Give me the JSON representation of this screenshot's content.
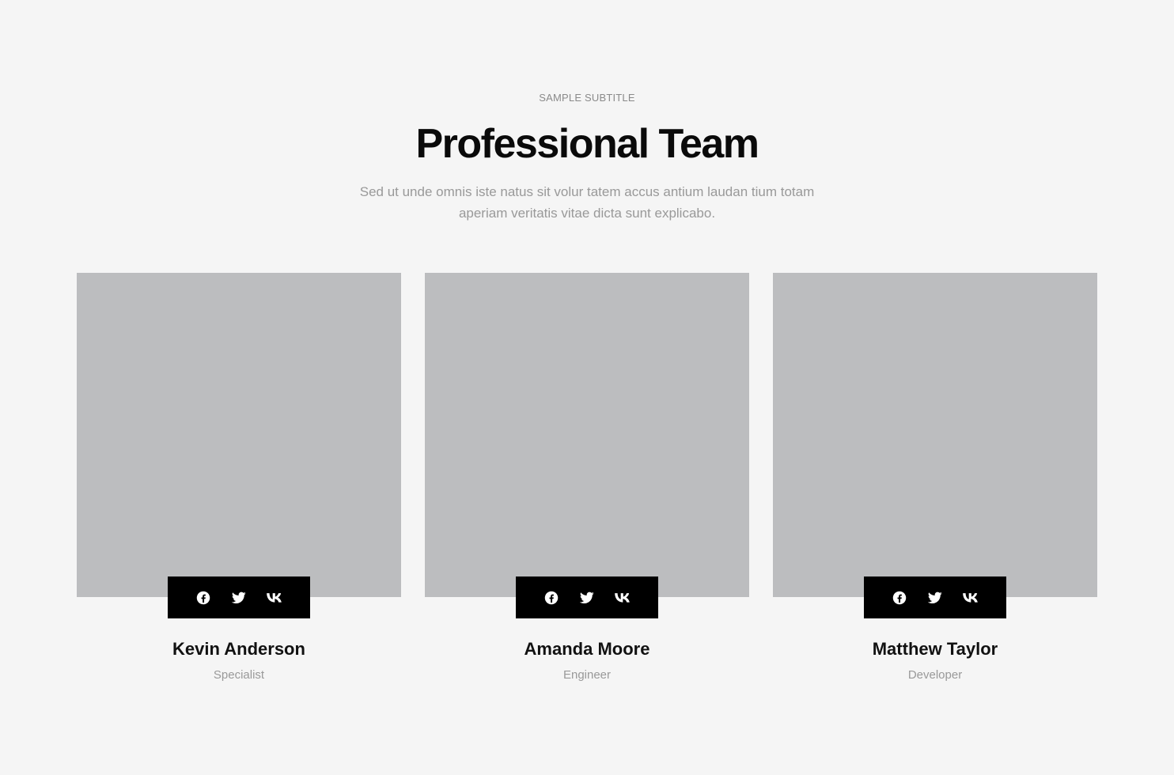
{
  "header": {
    "subtitle": "SAMPLE SUBTITLE",
    "title": "Professional Team",
    "description": "Sed ut unde omnis iste natus sit volur tatem accus antium laudan tium totam aperiam veritatis vitae dicta sunt explicabo."
  },
  "colors": {
    "background": "#f5f5f5",
    "photo_placeholder": "#bcbdbf",
    "social_bar": "#000000",
    "title": "#0a0a0a",
    "muted_text": "#999999"
  },
  "team": [
    {
      "name": "Kevin Anderson",
      "role": "Specialist",
      "socials": [
        "facebook-icon",
        "twitter-icon",
        "vk-icon"
      ]
    },
    {
      "name": "Amanda Moore",
      "role": "Engineer",
      "socials": [
        "facebook-icon",
        "twitter-icon",
        "vk-icon"
      ]
    },
    {
      "name": "Matthew Taylor",
      "role": "Developer",
      "socials": [
        "facebook-icon",
        "twitter-icon",
        "vk-icon"
      ]
    }
  ]
}
